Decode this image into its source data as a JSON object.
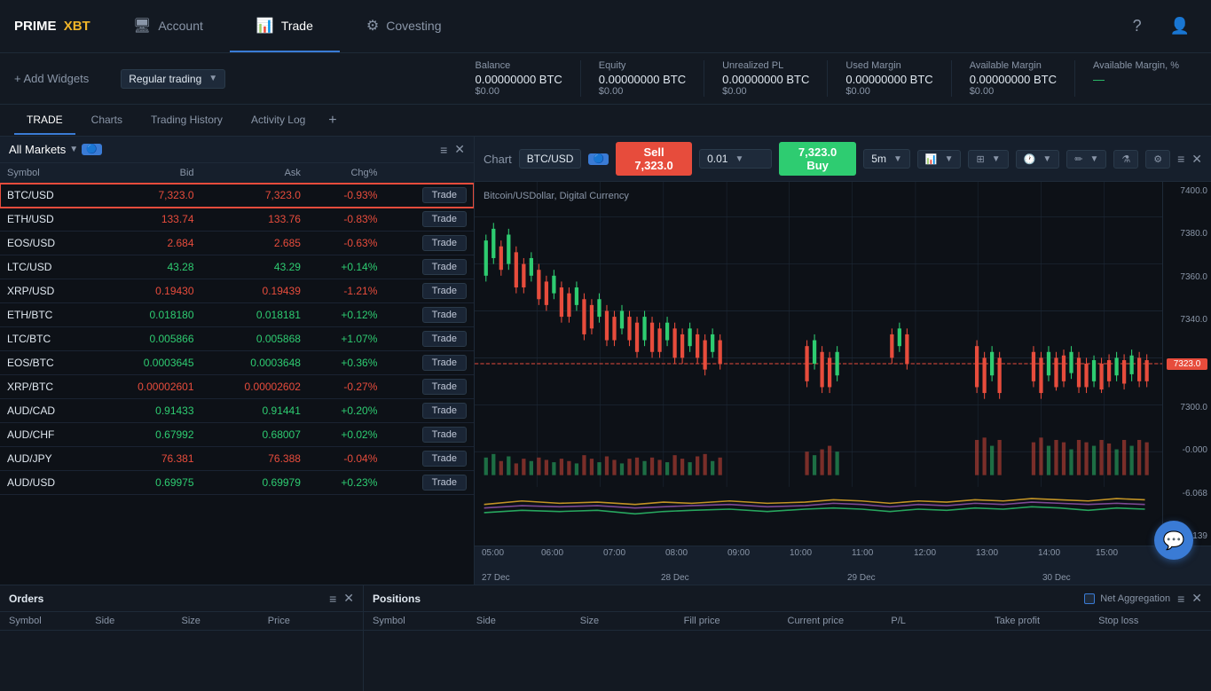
{
  "logo": {
    "prime": "PRIME",
    "xbt": "XBT"
  },
  "nav": {
    "tabs": [
      {
        "id": "account",
        "label": "Account",
        "icon": "🖥",
        "active": false
      },
      {
        "id": "trade",
        "label": "Trade",
        "icon": "📊",
        "active": true
      },
      {
        "id": "covesting",
        "label": "Covesting",
        "icon": "⚙",
        "active": false
      }
    ]
  },
  "header_icons": {
    "help": "?",
    "user": "👤"
  },
  "toolbar": {
    "add_widgets": "+ Add Widgets",
    "account_type": "Regular trading",
    "stats": [
      {
        "label": "Balance",
        "value": "0.00000000 BTC",
        "sub": "$0.00"
      },
      {
        "label": "Equity",
        "value": "0.00000000 BTC",
        "sub": "$0.00"
      },
      {
        "label": "Unrealized PL",
        "value": "0.00000000 BTC",
        "sub": "$0.00"
      },
      {
        "label": "Used Margin",
        "value": "0.00000000 BTC",
        "sub": "$0.00"
      },
      {
        "label": "Available Margin",
        "value": "0.00000000 BTC",
        "sub": "$0.00"
      },
      {
        "label": "Available Margin, %",
        "value": "—",
        "is_green": true
      }
    ]
  },
  "sub_tabs": [
    {
      "label": "TRADE",
      "active": true
    },
    {
      "label": "Charts",
      "active": false
    },
    {
      "label": "Trading History",
      "active": false
    },
    {
      "label": "Activity Log",
      "active": false
    }
  ],
  "markets": {
    "title": "All Markets",
    "badge": "🔵",
    "columns": [
      "Symbol",
      "Bid",
      "Ask",
      "Chg%",
      ""
    ],
    "rows": [
      {
        "symbol": "BTC/USD",
        "bid": "7,323.0",
        "ask": "7,323.0",
        "chg": "-0.93%",
        "neg": true,
        "selected": true
      },
      {
        "symbol": "ETH/USD",
        "bid": "133.74",
        "ask": "133.76",
        "chg": "-0.83%",
        "neg": true,
        "selected": false
      },
      {
        "symbol": "EOS/USD",
        "bid": "2.684",
        "ask": "2.685",
        "chg": "-0.63%",
        "neg": true,
        "selected": false
      },
      {
        "symbol": "LTC/USD",
        "bid": "43.28",
        "ask": "43.29",
        "chg": "+0.14%",
        "neg": false,
        "selected": false
      },
      {
        "symbol": "XRP/USD",
        "bid": "0.19430",
        "ask": "0.19439",
        "chg": "-1.21%",
        "neg": true,
        "selected": false
      },
      {
        "symbol": "ETH/BTC",
        "bid": "0.018180",
        "ask": "0.018181",
        "chg": "+0.12%",
        "neg": false,
        "selected": false
      },
      {
        "symbol": "LTC/BTC",
        "bid": "0.005866",
        "ask": "0.005868",
        "chg": "+1.07%",
        "neg": false,
        "selected": false
      },
      {
        "symbol": "EOS/BTC",
        "bid": "0.0003645",
        "ask": "0.0003648",
        "chg": "+0.36%",
        "neg": false,
        "selected": false
      },
      {
        "symbol": "XRP/BTC",
        "bid": "0.00002601",
        "ask": "0.00002602",
        "chg": "-0.27%",
        "neg": true,
        "selected": false
      },
      {
        "symbol": "AUD/CAD",
        "bid": "0.91433",
        "ask": "0.91441",
        "chg": "+0.20%",
        "neg": false,
        "selected": false
      },
      {
        "symbol": "AUD/CHF",
        "bid": "0.67992",
        "ask": "0.68007",
        "chg": "+0.02%",
        "neg": false,
        "selected": false
      },
      {
        "symbol": "AUD/JPY",
        "bid": "76.381",
        "ask": "76.388",
        "chg": "-0.04%",
        "neg": true,
        "selected": false
      },
      {
        "symbol": "AUD/USD",
        "bid": "0.69975",
        "ask": "0.69979",
        "chg": "+0.23%",
        "neg": false,
        "selected": false
      }
    ],
    "trade_btn": "Trade"
  },
  "chart": {
    "title": "Chart",
    "pair": "BTC/USD",
    "sell_label": "Sell 7,323.0",
    "amount": "0.01",
    "buy_label": "7,323.0 Buy",
    "timeframe": "5m",
    "description": "Bitcoin/USDollar, Digital Currency",
    "price_levels": [
      "7400.0",
      "7380.0",
      "7360.0",
      "7340.0",
      "7323.0",
      "7300.0",
      ""
    ],
    "time_labels": [
      "05:00",
      "06:00",
      "07:00",
      "08:00",
      "09:00",
      "10:00",
      "11:00",
      "12:00",
      "13:00",
      "14:00",
      "15:00"
    ],
    "date_labels": [
      "27 Dec",
      "28 Dec",
      "29 Dec",
      "30 Dec"
    ],
    "indicator_values": [
      "-0.000",
      "-6.068",
      "-12.139"
    ]
  },
  "orders": {
    "title": "Orders",
    "columns": [
      "Symbol",
      "Side",
      "Size",
      "Price"
    ]
  },
  "positions": {
    "title": "Positions",
    "net_aggregation": "Net Aggregation",
    "columns": [
      "Symbol",
      "Side",
      "Size",
      "Fill price",
      "Current price",
      "P/L",
      "Take profit",
      "Stop loss"
    ]
  },
  "chat_icon": "💬"
}
